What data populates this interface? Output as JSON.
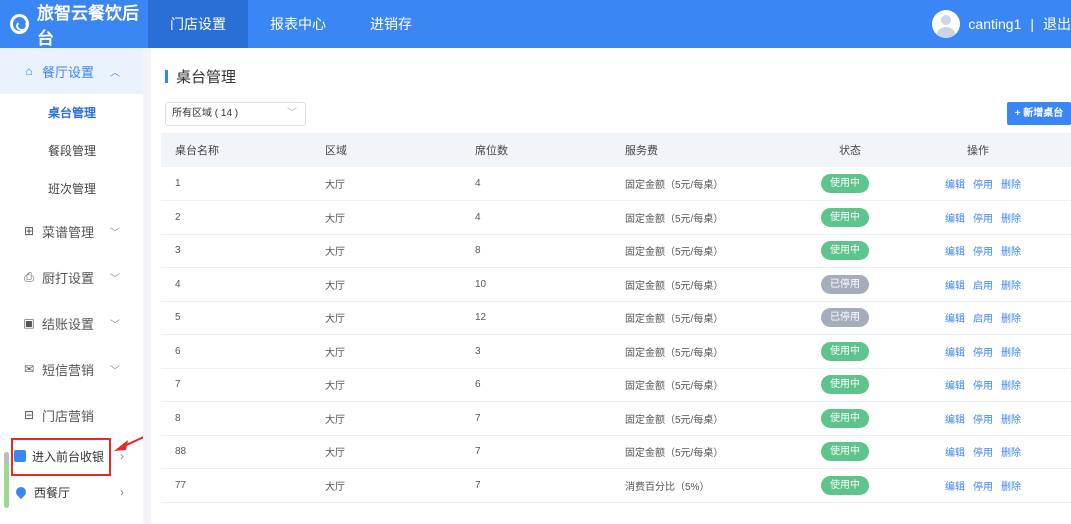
{
  "header": {
    "brand": "旅智云餐饮后台",
    "nav": [
      "门店设置",
      "报表中心",
      "进销存"
    ],
    "active_nav": 0,
    "username": "canting1",
    "separator": "|",
    "logout": "退出"
  },
  "sidebar": {
    "groups": [
      {
        "label": "餐厅设置",
        "icon": "home-icon",
        "chevron": "^"
      },
      {
        "label": "菜谱管理",
        "icon": "grid-icon",
        "chevron": "v"
      },
      {
        "label": "厨打设置",
        "icon": "printer-icon",
        "chevron": "v"
      },
      {
        "label": "结账设置",
        "icon": "checkout-icon",
        "chevron": "v"
      },
      {
        "label": "短信营销",
        "icon": "mail-icon",
        "chevron": "v"
      },
      {
        "label": "门店营销",
        "icon": "store-icon",
        "chevron": ""
      }
    ],
    "sub_items": [
      "桌台管理",
      "餐段管理",
      "班次管理"
    ],
    "bottom": [
      {
        "label": "进入前台收银",
        "icon": "cashier-icon"
      },
      {
        "label": "西餐厅",
        "icon": "location-pin-icon"
      }
    ]
  },
  "main": {
    "title": "桌台管理",
    "area_select": "所有区域 ( 14 )",
    "add_button": "+ 新增桌台",
    "columns": [
      "桌台名称",
      "区域",
      "席位数",
      "服务费",
      "状态",
      "操作"
    ],
    "rows": [
      {
        "name": "1",
        "area": "大厅",
        "seats": "4",
        "fee": "固定金额（5元/每桌）",
        "status": "使用中",
        "status_on": true,
        "ops": [
          "编辑",
          "停用",
          "删除"
        ]
      },
      {
        "name": "2",
        "area": "大厅",
        "seats": "4",
        "fee": "固定金额（5元/每桌）",
        "status": "使用中",
        "status_on": true,
        "ops": [
          "编辑",
          "停用",
          "删除"
        ]
      },
      {
        "name": "3",
        "area": "大厅",
        "seats": "8",
        "fee": "固定金额（5元/每桌）",
        "status": "使用中",
        "status_on": true,
        "ops": [
          "编辑",
          "停用",
          "删除"
        ]
      },
      {
        "name": "4",
        "area": "大厅",
        "seats": "10",
        "fee": "固定金额（5元/每桌）",
        "status": "已停用",
        "status_on": false,
        "ops": [
          "编辑",
          "启用",
          "删除"
        ]
      },
      {
        "name": "5",
        "area": "大厅",
        "seats": "12",
        "fee": "固定金额（5元/每桌）",
        "status": "已停用",
        "status_on": false,
        "ops": [
          "编辑",
          "启用",
          "删除"
        ]
      },
      {
        "name": "6",
        "area": "大厅",
        "seats": "3",
        "fee": "固定金额（5元/每桌）",
        "status": "使用中",
        "status_on": true,
        "ops": [
          "编辑",
          "停用",
          "删除"
        ]
      },
      {
        "name": "7",
        "area": "大厅",
        "seats": "6",
        "fee": "固定金额（5元/每桌）",
        "status": "使用中",
        "status_on": true,
        "ops": [
          "编辑",
          "停用",
          "删除"
        ]
      },
      {
        "name": "8",
        "area": "大厅",
        "seats": "7",
        "fee": "固定金额（5元/每桌）",
        "status": "使用中",
        "status_on": true,
        "ops": [
          "编辑",
          "停用",
          "删除"
        ]
      },
      {
        "name": "88",
        "area": "大厅",
        "seats": "7",
        "fee": "固定金额（5元/每桌）",
        "status": "使用中",
        "status_on": true,
        "ops": [
          "编辑",
          "停用",
          "删除"
        ]
      },
      {
        "name": "77",
        "area": "大厅",
        "seats": "7",
        "fee": "消费百分比（5%）",
        "status": "使用中",
        "status_on": true,
        "ops": [
          "编辑",
          "停用",
          "删除"
        ]
      }
    ]
  },
  "colors": {
    "primary": "#3b86f5",
    "status_on": "#5dc48c",
    "status_off": "#a5adbd",
    "highlight": "#e52a2a"
  }
}
